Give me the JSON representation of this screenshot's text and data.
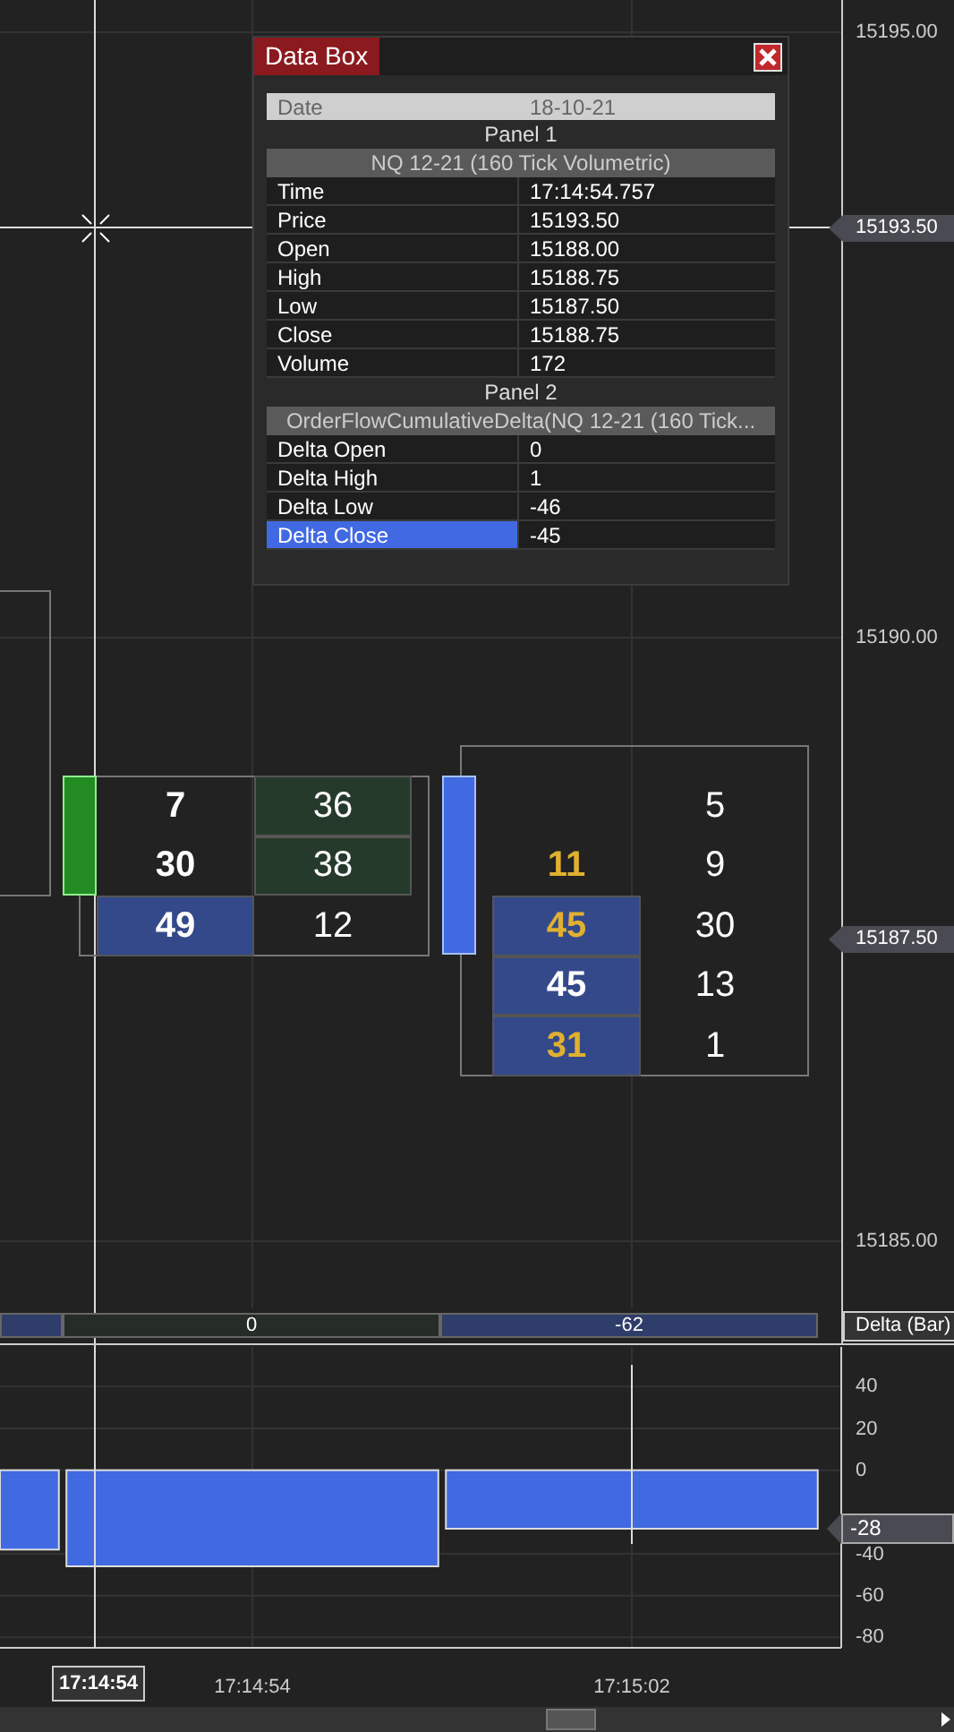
{
  "data_box": {
    "title": "Data Box",
    "rows": [
      {
        "kind": "date",
        "label": "Date",
        "value": "18-10-21"
      },
      {
        "kind": "section",
        "label": "Panel 1"
      },
      {
        "kind": "source",
        "label": "NQ 12-21 (160 Tick Volumetric)"
      },
      {
        "kind": "field",
        "label": "Time",
        "value": "17:14:54.757",
        "selected": false
      },
      {
        "kind": "field",
        "label": "Price",
        "value": "15193.50",
        "selected": false
      },
      {
        "kind": "field",
        "label": "Open",
        "value": "15188.00",
        "selected": false
      },
      {
        "kind": "field",
        "label": "High",
        "value": "15188.75",
        "selected": false
      },
      {
        "kind": "field",
        "label": "Low",
        "value": "15187.50",
        "selected": false
      },
      {
        "kind": "field",
        "label": "Close",
        "value": "15188.75",
        "selected": false
      },
      {
        "kind": "field",
        "label": "Volume",
        "value": "172",
        "selected": false
      },
      {
        "kind": "section",
        "label": "Panel 2"
      },
      {
        "kind": "source",
        "label": "OrderFlowCumulativeDelta(NQ 12-21 (160 Tick..."
      },
      {
        "kind": "field",
        "label": "Delta Open",
        "value": "0",
        "selected": false
      },
      {
        "kind": "field",
        "label": "Delta High",
        "value": "1",
        "selected": false
      },
      {
        "kind": "field",
        "label": "Delta Low",
        "value": "-46",
        "selected": false
      },
      {
        "kind": "field",
        "label": "Delta Close",
        "value": "-45",
        "selected": true
      }
    ]
  },
  "price_axis": {
    "labels": [
      "15195.00",
      "15190.00",
      "15185.00"
    ],
    "markers": [
      "15193.50",
      "15187.50"
    ]
  },
  "footprint": {
    "bars": [
      {
        "rising": true,
        "rows": [
          {
            "bid": "7",
            "ask": "36",
            "color": "#ffffff",
            "bid_shade": false,
            "ask_shade": true
          },
          {
            "bid": "30",
            "ask": "38",
            "color": "#ffffff",
            "bid_shade": false,
            "ask_shade": true
          },
          {
            "bid": "49",
            "ask": "12",
            "color": "#ffffff",
            "bid_shade": true,
            "ask_shade": false
          }
        ]
      },
      {
        "rising": false,
        "rows": [
          {
            "ask": "5",
            "ask_shade": false
          },
          {
            "bid": "11",
            "ask": "9",
            "color": "#e0b030",
            "bid_shade": false,
            "ask_shade": false
          },
          {
            "bid": "45",
            "ask": "30",
            "color": "#e0b030",
            "bid_shade": true,
            "ask_shade": false
          },
          {
            "bid": "45",
            "ask": "13",
            "color": "#ffffff",
            "bid_shade": true,
            "ask_shade": false
          },
          {
            "bid": "31",
            "ask": "1",
            "color": "#e0b030",
            "bid_shade": true,
            "ask_shade": false
          }
        ]
      }
    ]
  },
  "delta_strip": {
    "cells": [
      "0",
      "-62"
    ],
    "label": "Delta (Bar)"
  },
  "delta_panel": {
    "marker": "-28",
    "chart_data": {
      "type": "bar",
      "categories": [
        null,
        "17:14:54",
        "17:15:02"
      ],
      "values": [
        -38,
        -46,
        -28
      ],
      "ylim": [
        -85,
        59
      ],
      "yticks": [
        40,
        20,
        0,
        -40,
        -60,
        -80
      ],
      "grid": true
    }
  },
  "time_axis": {
    "crosshair_time": "17:14:54"
  }
}
